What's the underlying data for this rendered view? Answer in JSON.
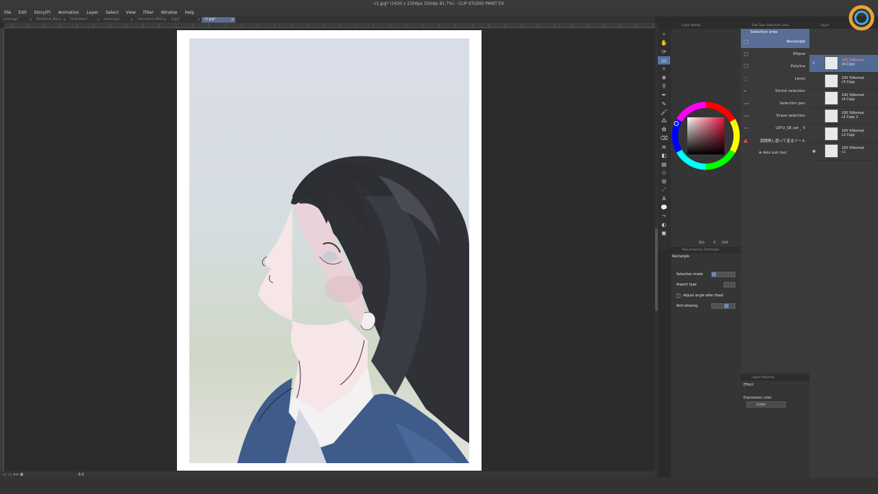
{
  "window_title": "c1.jpg* (1630 x 2356px 350dpi 81.7%) - CLIP STUDIO PAINT EX",
  "menu": [
    "File",
    "Edit",
    "Story(P)",
    "Animation",
    "Layer",
    "Select",
    "View",
    "Filter",
    "Window",
    "Help"
  ],
  "tabs": [
    {
      "label": "cover.jpg*",
      "active": false
    },
    {
      "label": "Portfolio4_Mono",
      "active": false
    },
    {
      "label": "Illustration*",
      "active": false
    },
    {
      "label": "sweet.jpg*",
      "active": false
    },
    {
      "label": "Hana dress 09(2)",
      "active": false
    },
    {
      "label": "3.jpg*",
      "active": false
    },
    {
      "label": "c1.jpg*",
      "active": true
    }
  ],
  "status": {
    "zoom": "0.0"
  },
  "colors": {
    "accent": "#5575a6",
    "panel_bg": "#3a3a3a",
    "canvas_bg": "#2c2c2c",
    "hair": "#2e3036",
    "uniform": "#3e5b8a"
  },
  "color_panel": {
    "tab": "Color Wheel",
    "readout": "351",
    "readout2": "0",
    "readout3": "100"
  },
  "subtool": {
    "tab": "Sub Tool: Selection area",
    "header": "Selection area",
    "items": [
      {
        "label": "Rectangle",
        "active": true,
        "icon": "rectangle-select-icon"
      },
      {
        "label": "Ellipse",
        "active": false,
        "icon": "ellipse-select-icon"
      },
      {
        "label": "Polyline",
        "active": false,
        "icon": "polyline-select-icon"
      },
      {
        "label": "Lasso",
        "active": false,
        "icon": "lasso-icon"
      },
      {
        "label": "Shrink selection",
        "active": false,
        "icon": "shrink-selection-icon"
      },
      {
        "label": "Selection pen",
        "active": false,
        "icon": "selection-pen-icon"
      },
      {
        "label": "Erase selection",
        "active": false,
        "icon": "erase-selection-icon"
      },
      {
        "label": "LEFU_SE set _ 5",
        "active": false,
        "icon": "brush-set-icon"
      },
      {
        "label": "囲聞無し囲って塗るツール",
        "active": false,
        "icon": "fill-tool-icon"
      }
    ],
    "add_sub_tool": "Add sub tool"
  },
  "tool_property": {
    "tab": "Tool property: Rectangle",
    "title": "Rectangle",
    "rows": [
      "Selection mode",
      "Aspect type",
      "Adjust angle after fixed",
      "Anti-aliasing"
    ]
  },
  "layer_property": {
    "tab": "Layer Property",
    "effect": "Effect",
    "expression_color_label": "Expression color",
    "expression_color_value": "Color"
  },
  "layers": {
    "tab": "Layer",
    "items": [
      {
        "mode": "100 %Normal",
        "name": "c6 Copy",
        "active": true
      },
      {
        "mode": "100 %Normal",
        "name": "c5 Copy",
        "active": false
      },
      {
        "mode": "100 %Normal",
        "name": "c4 Copy",
        "active": false
      },
      {
        "mode": "100 %Normal",
        "name": "c2 Copy 2",
        "active": false
      },
      {
        "mode": "100 %Normal",
        "name": "c2 Copy",
        "active": false
      },
      {
        "mode": "100 %Normal",
        "name": "c1",
        "active": false
      }
    ]
  },
  "tools": [
    "zoom-icon",
    "hand-icon",
    "rotate-icon",
    "selection-icon",
    "auto-select-icon",
    "move-icon",
    "eyedropper-icon",
    "pen-icon",
    "pencil-icon",
    "brush-icon",
    "airbrush-icon",
    "decoration-icon",
    "eraser-icon",
    "blend-icon",
    "fill-icon",
    "gradient-icon",
    "figure-icon",
    "frame-icon",
    "ruler-icon",
    "text-icon",
    "balloon-icon",
    "correct-line-icon",
    "lasso-fill-icon",
    "color-swatch-icon"
  ]
}
